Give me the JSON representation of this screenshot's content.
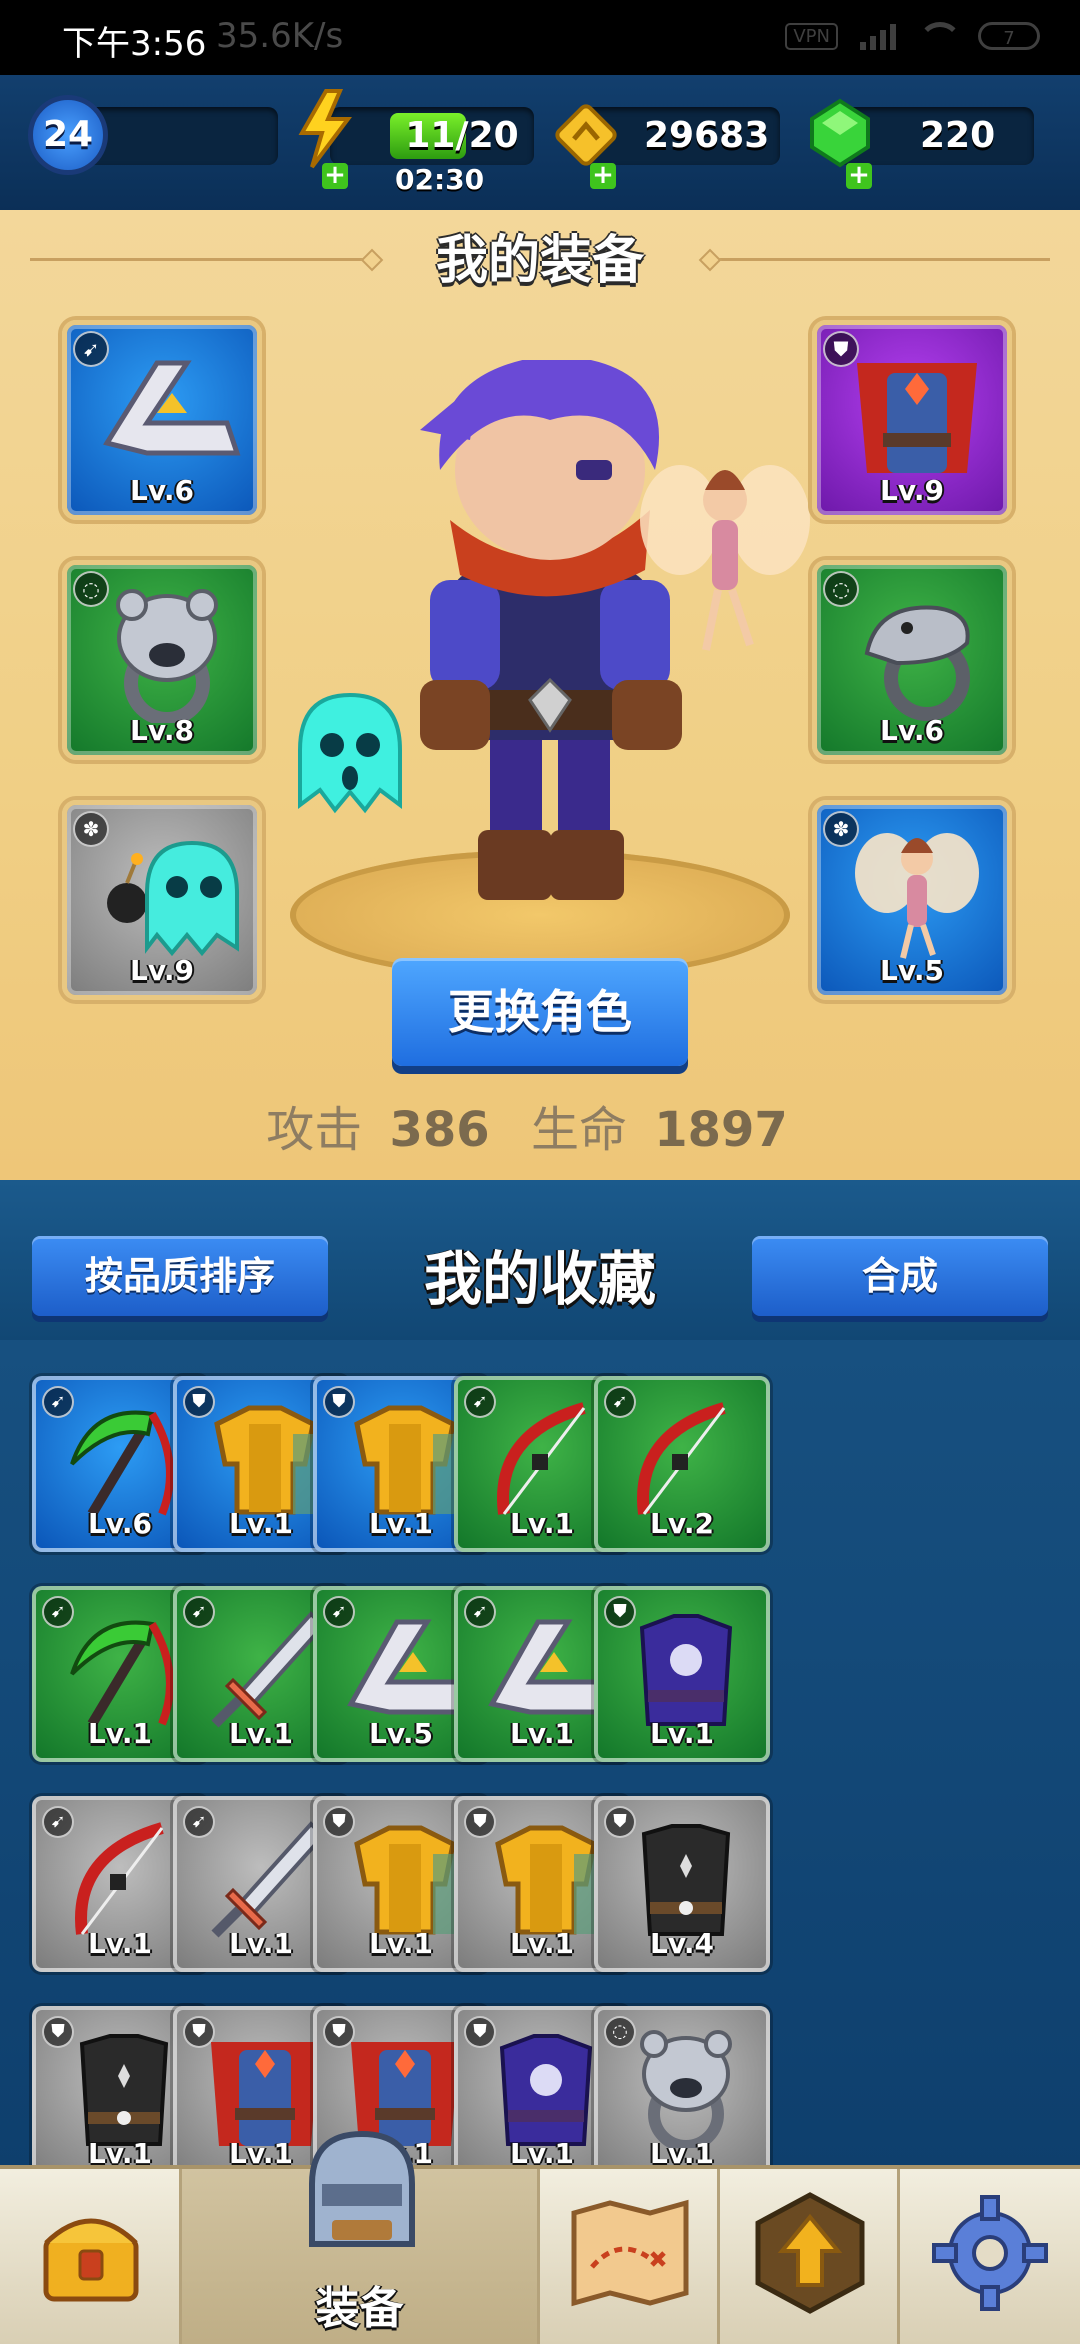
{
  "status_bar": {
    "time": "下午3:56",
    "net_speed": "35.6K/s",
    "vpn": "VPN",
    "battery": "7"
  },
  "resources": {
    "player_level": "24",
    "energy": "11/20",
    "energy_fraction": 0.55,
    "energy_timer": "02:30",
    "gold": "29683",
    "gems": "220",
    "plus": "+"
  },
  "equipment": {
    "title": "我的装备",
    "slots": [
      {
        "slot": "weapon",
        "quality": "blue",
        "icon": "boomerang-icon",
        "badge_icon": "weapon-type-icon",
        "level": "Lv.6"
      },
      {
        "slot": "armor",
        "quality": "purple",
        "icon": "caped-armor-icon",
        "badge_icon": "armor-type-icon",
        "level": "Lv.9"
      },
      {
        "slot": "ring-1",
        "quality": "green",
        "icon": "bear-ring-icon",
        "badge_icon": "ring-type-icon",
        "level": "Lv.8"
      },
      {
        "slot": "ring-2",
        "quality": "green",
        "icon": "serpent-ring-icon",
        "badge_icon": "ring-type-icon",
        "level": "Lv.6"
      },
      {
        "slot": "pet-1",
        "quality": "grey",
        "icon": "ghost-bomb-pet-icon",
        "badge_icon": "paw-icon",
        "level": "Lv.9"
      },
      {
        "slot": "pet-2",
        "quality": "blue",
        "icon": "fairy-pet-icon",
        "badge_icon": "paw-icon",
        "level": "Lv.5"
      }
    ],
    "change_character": "更换角色",
    "attack_label": "攻击",
    "attack_value": "386",
    "hp_label": "生命",
    "hp_value": "1897"
  },
  "collection": {
    "title": "我的收藏",
    "sort_button": "按品质排序",
    "merge_button": "合成",
    "items": [
      {
        "quality": "blue",
        "icon": "scythe-icon",
        "level": "Lv.6"
      },
      {
        "quality": "blue",
        "icon": "gold-armor-icon",
        "level": "Lv.1"
      },
      {
        "quality": "blue",
        "icon": "gold-armor-icon",
        "level": "Lv.1"
      },
      {
        "quality": "green",
        "icon": "bow-icon",
        "level": "Lv.1"
      },
      {
        "quality": "green",
        "icon": "bow-icon",
        "level": "Lv.2"
      },
      {
        "quality": "green",
        "icon": "scythe-icon",
        "level": "Lv.1"
      },
      {
        "quality": "green",
        "icon": "sword-icon",
        "level": "Lv.1"
      },
      {
        "quality": "green",
        "icon": "boomerang-icon",
        "level": "Lv.5"
      },
      {
        "quality": "green",
        "icon": "boomerang-icon",
        "level": "Lv.1"
      },
      {
        "quality": "green",
        "icon": "violet-robe-icon",
        "level": "Lv.1"
      },
      {
        "quality": "grey",
        "icon": "bow-icon",
        "level": "Lv.1"
      },
      {
        "quality": "grey",
        "icon": "sword-icon",
        "level": "Lv.1"
      },
      {
        "quality": "grey",
        "icon": "gold-armor-icon",
        "level": "Lv.1"
      },
      {
        "quality": "grey",
        "icon": "gold-armor-icon",
        "level": "Lv.1"
      },
      {
        "quality": "grey",
        "icon": "dark-vest-icon",
        "level": "Lv.4"
      },
      {
        "quality": "grey",
        "icon": "dark-vest-icon",
        "level": "Lv.1"
      },
      {
        "quality": "grey",
        "icon": "caped-armor-icon",
        "level": "Lv.1"
      },
      {
        "quality": "grey",
        "icon": "caped-armor-icon",
        "level": "Lv.1"
      },
      {
        "quality": "grey",
        "icon": "violet-robe-icon",
        "level": "Lv.1"
      },
      {
        "quality": "grey",
        "icon": "bear-ring-icon",
        "level": "Lv.1"
      }
    ]
  },
  "nav": {
    "tabs": [
      {
        "name": "chest",
        "icon": "treasure-chest-icon",
        "label": ""
      },
      {
        "name": "equipment",
        "icon": "helmet-armor-icon",
        "label": "装备"
      },
      {
        "name": "map",
        "icon": "map-icon",
        "label": ""
      },
      {
        "name": "upgrade",
        "icon": "upgrade-arrow-icon",
        "label": ""
      },
      {
        "name": "settings",
        "icon": "gear-icon",
        "label": ""
      }
    ]
  },
  "colors": {
    "blue": "#1a7ae0",
    "green": "#2a9a38",
    "grey": "#a0a0a0",
    "purple": "#8f2fd0",
    "panel": "#f2d492"
  }
}
